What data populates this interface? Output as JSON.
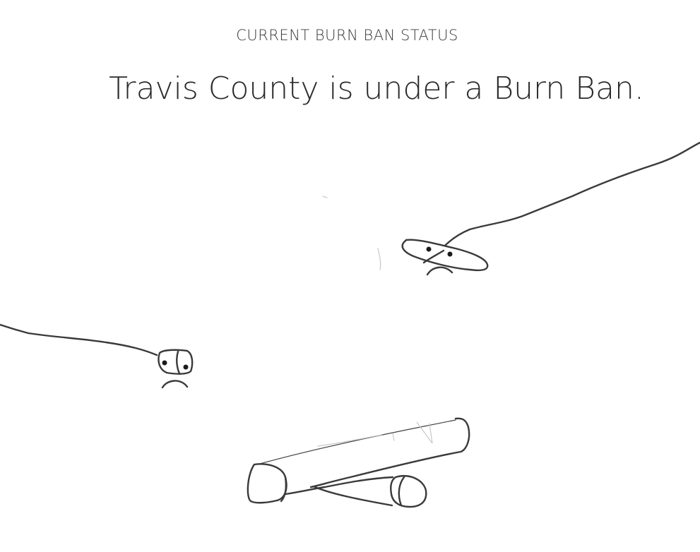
{
  "header": {
    "label": "CURRENT BURN BAN STATUS"
  },
  "status": {
    "headline": "Travis County is under a Burn Ban."
  },
  "illustration": {
    "description_icons": [
      "sad-match-icon",
      "sad-match-icon",
      "unlit-campfire-log-icon"
    ]
  }
}
